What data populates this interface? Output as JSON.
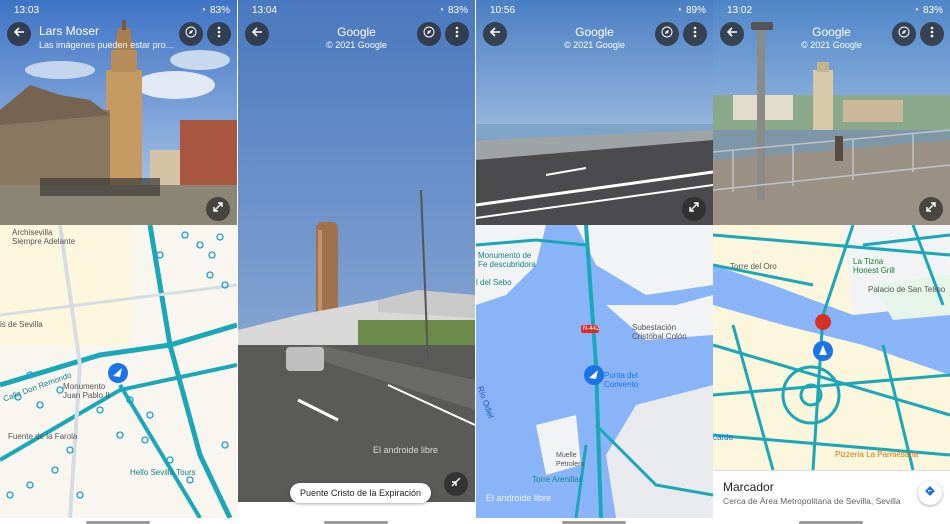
{
  "panels": [
    {
      "status": {
        "time": "13:03",
        "battery": "83%"
      },
      "header": {
        "title": "Lars Moser",
        "subtitle": "Las imágenes pueden estar pro..."
      },
      "map_labels": {
        "archivo": "Archisevilla\nSiempre Adelante",
        "sevilla": "is de Sevilla",
        "monumento": "Monumento\nJuan Pablo II",
        "farola": "Fuente de la Farola",
        "tours": "Hello Sevilla Tours",
        "calle": "Calle Don Remondo"
      }
    },
    {
      "status": {
        "time": "13:04",
        "battery": "83%"
      },
      "header": {
        "title": "Google",
        "subtitle": "© 2021 Google"
      },
      "watermark": "El androide libre",
      "location_chip": "Puente Cristo de la Expiración"
    },
    {
      "status": {
        "time": "10:56",
        "battery": "89%"
      },
      "header": {
        "title": "Google",
        "subtitle": "© 2021 Google"
      },
      "map_labels": {
        "monumento": "Monumento de\nFe descubridora",
        "sebo": "l del Sebo",
        "road": "N-442",
        "subestacion": "Subestación\nCristóbal Colón",
        "punta": "Punta del\nConvento",
        "rio": "Río Odiel",
        "muelle": "Muelle\nPetrolero",
        "torre": "Torre Arenillas"
      },
      "watermark": "El androide libre"
    },
    {
      "status": {
        "time": "13:02",
        "battery": "83%"
      },
      "header": {
        "title": "Google",
        "subtitle": "© 2021 Google"
      },
      "map_labels": {
        "torre_oro": "Torre del Oro",
        "tizna": "La Tizna\nHonest Grill",
        "palacio": "Palacio de San Telmo",
        "cardo": "cardo",
        "pizzeria": "Pizzería La Parmesana"
      },
      "card": {
        "title": "Marcador",
        "subtitle": "Cerca de Área Metropolitana de Sevilla, Sevilla"
      }
    }
  ]
}
